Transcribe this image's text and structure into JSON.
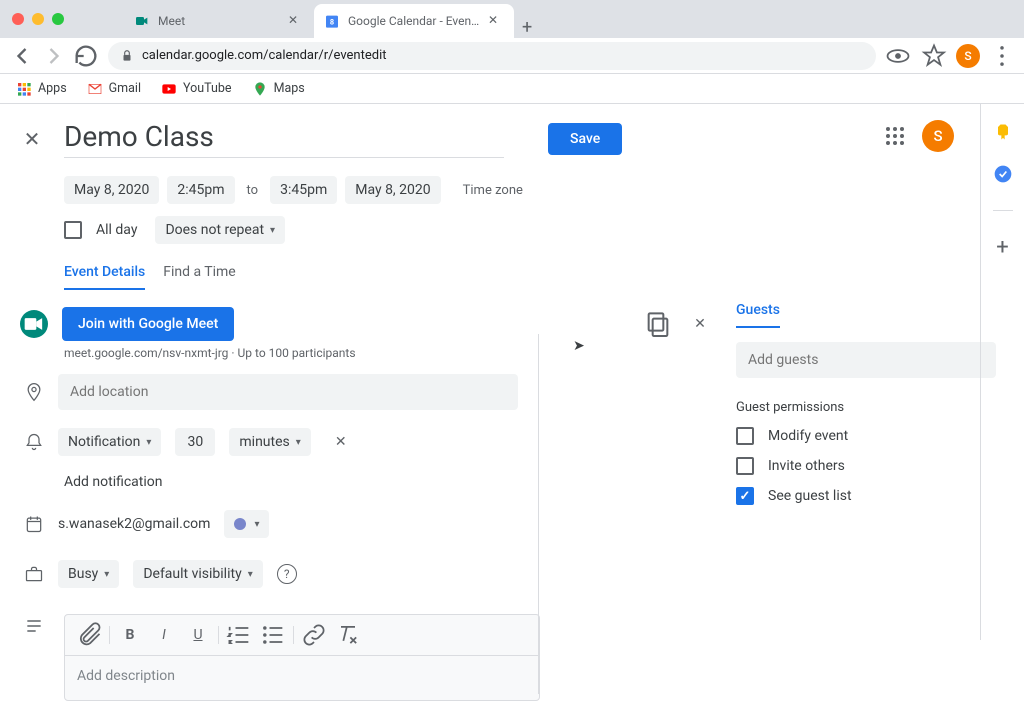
{
  "browser": {
    "tabs": [
      {
        "title": "Meet",
        "favicon": "meet"
      },
      {
        "title": "Google Calendar - Event detail",
        "favicon": "calendar"
      }
    ],
    "url": "calendar.google.com/calendar/r/eventedit",
    "bookmarks": [
      {
        "label": "Apps",
        "icon": "apps"
      },
      {
        "label": "Gmail",
        "icon": "gmail"
      },
      {
        "label": "YouTube",
        "icon": "youtube"
      },
      {
        "label": "Maps",
        "icon": "maps"
      }
    ],
    "avatar_letter": "S"
  },
  "event": {
    "title": "Demo Class",
    "save_label": "Save",
    "date_start": "May 8, 2020",
    "time_start": "2:45pm",
    "to_label": "to",
    "time_end": "3:45pm",
    "date_end": "May 8, 2020",
    "timezone_label": "Time zone",
    "allday_label": "All day",
    "repeat_label": "Does not repeat",
    "tabs": {
      "details": "Event Details",
      "findtime": "Find a Time"
    },
    "meet_button": "Join with Google Meet",
    "meet_link": "meet.google.com/nsv-nxmt-jrg",
    "meet_participants": "Up to 100 participants",
    "location_placeholder": "Add location",
    "notification": {
      "type": "Notification",
      "value": "30",
      "unit": "minutes"
    },
    "add_notification": "Add notification",
    "organizer_email": "s.wanasek2@gmail.com",
    "busy_label": "Busy",
    "visibility_label": "Default visibility",
    "description_placeholder": "Add description"
  },
  "guests": {
    "tab_label": "Guests",
    "add_placeholder": "Add guests",
    "permissions_title": "Guest permissions",
    "modify_label": "Modify event",
    "invite_label": "Invite others",
    "seelist_label": "See guest list"
  }
}
